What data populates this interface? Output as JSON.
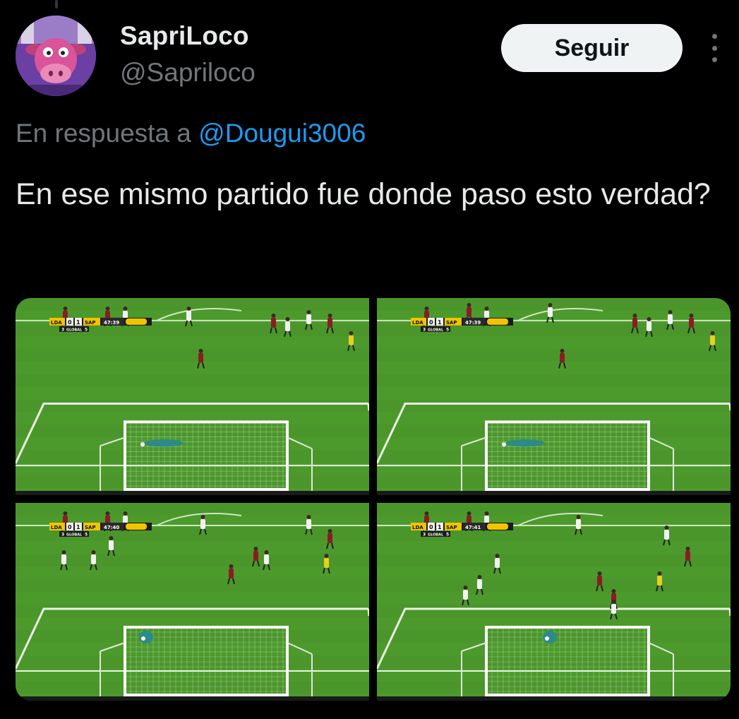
{
  "user": {
    "display_name": "SapriLoco",
    "handle": "@Sapriloco",
    "avatar_icon": "pink-cow-mascot-avatar"
  },
  "follow_button": {
    "label": "Seguir"
  },
  "more_menu": {
    "icon": "more-vertical-icon"
  },
  "reply": {
    "prefix": "En respuesta a",
    "mention": "@Dougui3006"
  },
  "tweet": {
    "text": "En ese mismo partido fue donde paso esto verdad?"
  },
  "media": [
    {
      "home": "LDA",
      "home_score": "0",
      "away_score": "1",
      "away": "SAP",
      "clock": "47:39",
      "agg_home": "3",
      "agg_label": "GLOBAL",
      "agg_away": "5"
    },
    {
      "home": "LDA",
      "home_score": "0",
      "away_score": "1",
      "away": "SAP",
      "clock": "47:39",
      "agg_home": "3",
      "agg_label": "GLOBAL",
      "agg_away": "5"
    },
    {
      "home": "LDA",
      "home_score": "0",
      "away_score": "1",
      "away": "SAP",
      "clock": "47:40",
      "agg_home": "3",
      "agg_label": "GLOBAL",
      "agg_away": "5"
    },
    {
      "home": "LDA",
      "home_score": "0",
      "away_score": "1",
      "away": "SAP",
      "clock": "47:41",
      "agg_home": "3",
      "agg_label": "GLOBAL",
      "agg_away": "5"
    }
  ],
  "colors": {
    "background": "#000000",
    "link": "#1d9bf0",
    "secondary_text": "#71767b",
    "pitch": "#4d9a2c"
  }
}
